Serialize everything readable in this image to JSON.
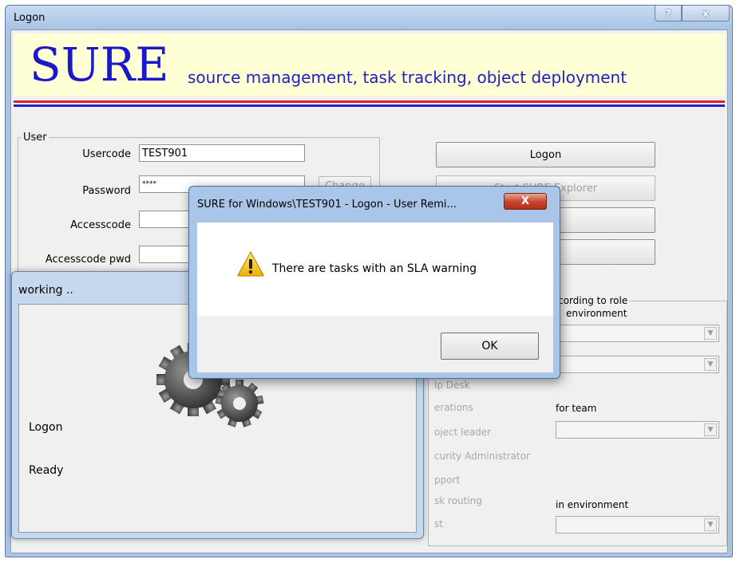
{
  "main_window": {
    "title": "Logon",
    "help_label": "?",
    "close_label": "x",
    "banner": {
      "logo": "SURE",
      "tagline": "source management, task tracking, object deployment",
      "accent_colors": {
        "red": "#e02020",
        "blue": "#2020c8",
        "banner_bg": "#ffffd5"
      }
    },
    "user_group": {
      "legend": "User",
      "usercode_label": "Usercode",
      "usercode_value": "TEST901",
      "password_label": "Password",
      "password_value": "****",
      "change_button": "Change",
      "accesscode_label": "Accesscode",
      "accesscode_value": "",
      "accesscode_pwd_label": "Accesscode pwd",
      "accesscode_pwd_value": ""
    },
    "buttons": {
      "logon": "Logon",
      "start_explorer": "Start SURE Explorer"
    },
    "role_group": {
      "legend": "cording to role",
      "environment_label": "environment",
      "roles": [
        "lp Desk",
        "erations",
        "oject leader",
        "curity Administrator",
        "pport",
        "sk routing",
        "st"
      ],
      "for_team_label": "for team",
      "in_environment_label": "in environment"
    }
  },
  "working_window": {
    "title": "working ..",
    "icon": "gears-icon",
    "step": "Logon",
    "status": "Ready"
  },
  "message_dialog": {
    "title": "SURE for Windows\\TEST901 - Logon - User Remi...",
    "close_label": "X",
    "icon": "warning-icon",
    "message": "There are tasks with an SLA warning",
    "ok_label": "OK"
  }
}
